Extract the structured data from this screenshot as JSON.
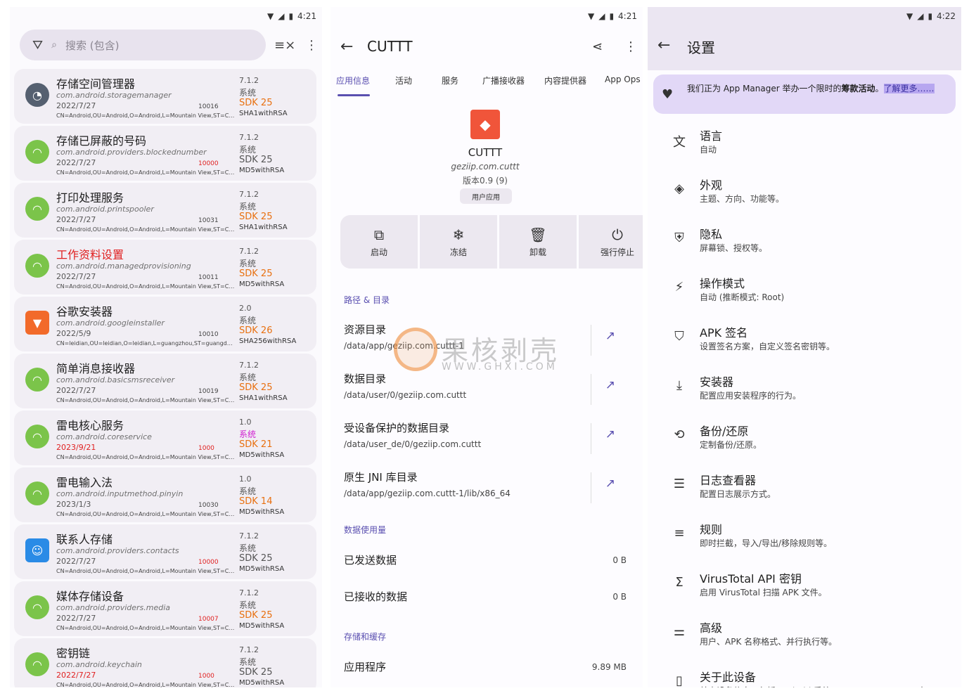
{
  "panel1": {
    "status": {
      "time": "4:21"
    },
    "search": {
      "placeholder": "搜索 (包含)"
    },
    "apps": [
      {
        "name": "存储空间管理器",
        "pkg": "com.android.storagemanager",
        "date": "2022/7/27",
        "uid": "10016",
        "cert": "CN=Android,OU=Android,O=Android,L=Mountain View,ST=Cali...",
        "version": "7.1.2",
        "type": "系统",
        "sdk": "SDK 25",
        "sig": "SHA1withRSA",
        "icon": "storage-icon"
      },
      {
        "name": "存储已屏蔽的号码",
        "pkg": "com.android.providers.blockednumber",
        "date": "2022/7/27",
        "uid": "10000",
        "cert": "CN=Android,OU=Android,O=Android,L=Mountain View,ST=Cali...",
        "version": "7.1.2",
        "type": "系统",
        "sdk": "SDK 25",
        "sig": "MD5withRSA",
        "icon": "android-icon"
      },
      {
        "name": "打印处理服务",
        "pkg": "com.android.printspooler",
        "date": "2022/7/27",
        "uid": "10031",
        "cert": "CN=Android,OU=Android,O=Android,L=Mountain View,ST=Cali...",
        "version": "7.1.2",
        "type": "系统",
        "sdk": "SDK 25",
        "sig": "SHA1withRSA",
        "icon": "android-icon"
      },
      {
        "name": "工作资料设置",
        "pkg": "com.android.managedprovisioning",
        "date": "2022/7/27",
        "uid": "10011",
        "cert": "CN=Android,OU=Android,O=Android,L=Mountain View,ST=Cali...",
        "version": "7.1.2",
        "type": "系统",
        "sdk": "SDK 25",
        "sig": "MD5withRSA",
        "icon": "android-icon"
      },
      {
        "name": "谷歌安装器",
        "pkg": "com.android.googleinstaller",
        "date": "2022/5/9",
        "uid": "10010",
        "cert": "CN=leidian,OU=leidian,O=leidian,L=guangzhou,ST=guangdon...",
        "version": "2.0",
        "type": "系统",
        "sdk": "SDK 26",
        "sig": "SHA256withRSA",
        "icon": "installer-icon"
      },
      {
        "name": "简单消息接收器",
        "pkg": "com.android.basicsmsreceiver",
        "date": "2022/7/27",
        "uid": "10019",
        "cert": "CN=Android,OU=Android,O=Android,L=Mountain View,ST=Cali...",
        "version": "7.1.2",
        "type": "系统",
        "sdk": "SDK 25",
        "sig": "SHA1withRSA",
        "icon": "android-icon"
      },
      {
        "name": "雷电核心服务",
        "pkg": "com.android.coreservice",
        "date": "2023/9/21",
        "uid": "1000",
        "cert": "CN=Android,OU=Android,O=Android,L=Mountain View,ST=Cali...",
        "version": "1.0",
        "type": "系统",
        "sdk": "SDK 21",
        "sig": "MD5withRSA",
        "icon": "android-icon"
      },
      {
        "name": "雷电输入法",
        "pkg": "com.android.inputmethod.pinyin",
        "date": "2023/1/3",
        "uid": "10030",
        "cert": "CN=Android,OU=Android,O=Android,L=Mountain View,ST=Cali...",
        "version": "1.0",
        "type": "系统",
        "sdk": "SDK 14",
        "sig": "MD5withRSA",
        "icon": "android-icon"
      },
      {
        "name": "联系人存储",
        "pkg": "com.android.providers.contacts",
        "date": "2022/7/27",
        "uid": "10000",
        "cert": "CN=Android,OU=Android,O=Android,L=Mountain View,ST=Cali...",
        "version": "7.1.2",
        "type": "系统",
        "sdk": "SDK 25",
        "sig": "MD5withRSA",
        "icon": "contacts-icon"
      },
      {
        "name": "媒体存储设备",
        "pkg": "com.android.providers.media",
        "date": "2022/7/27",
        "uid": "10007",
        "cert": "CN=Android,OU=Android,O=Android,L=Mountain View,ST=Cali...",
        "version": "7.1.2",
        "type": "系统",
        "sdk": "SDK 25",
        "sig": "MD5withRSA",
        "icon": "android-icon"
      },
      {
        "name": "密钥链",
        "pkg": "com.android.keychain",
        "date": "2022/7/27",
        "uid": "1000",
        "cert": "CN=Android,OU=Android,O=Android,L=Mountain View,ST=Cali...",
        "version": "7.1.2",
        "type": "系统",
        "sdk": "SDK 25",
        "sig": "MD5withRSA",
        "icon": "android-icon"
      }
    ]
  },
  "panel2": {
    "status": {
      "time": "4:21"
    },
    "title": "CUTTT",
    "tabs": [
      "应用信息",
      "活动",
      "服务",
      "广播接收器",
      "内容提供器",
      "App Ops"
    ],
    "app": {
      "name": "CUTTT",
      "pkg": "geziip.com.cuttt",
      "version": "版本0.9 (9)",
      "chip": "用户应用"
    },
    "actions": [
      {
        "label": "启动",
        "icon": "launch-icon"
      },
      {
        "label": "冻结",
        "icon": "freeze-icon"
      },
      {
        "label": "卸载",
        "icon": "trash-icon"
      },
      {
        "label": "强行停止",
        "icon": "power-icon"
      }
    ],
    "paths_header": "路径 & 目录",
    "paths": [
      {
        "title": "资源目录",
        "sub": "/data/app/geziip.com.cuttt-1"
      },
      {
        "title": "数据目录",
        "sub": "/data/user/0/geziip.com.cuttt"
      },
      {
        "title": "受设备保护的数据目录",
        "sub": "/data/user_de/0/geziip.com.cuttt"
      },
      {
        "title": "原生 JNI 库目录",
        "sub": "/data/app/geziip.com.cuttt-1/lib/x86_64"
      }
    ],
    "usage_header": "数据使用量",
    "usage": [
      {
        "label": "已发送数据",
        "value": "0 B"
      },
      {
        "label": "已接收的数据",
        "value": "0 B"
      }
    ],
    "storage_header": "存储和缓存",
    "storage": [
      {
        "label": "应用程序",
        "value": "9.89 MB"
      }
    ],
    "watermark": {
      "text": "果核剥壳",
      "sub": "WWW.GHXI.COM"
    }
  },
  "panel3": {
    "status": {
      "time": "4:22"
    },
    "title": "设置",
    "banner": {
      "text": "我们正为 App Manager 举办一个限时的",
      "bold": "筹款活动",
      "end": "。",
      "link": "了解更多……"
    },
    "settings": [
      {
        "title": "语言",
        "sub": "自动",
        "icon": "translate-icon"
      },
      {
        "title": "外观",
        "sub": "主题、方向、功能等。",
        "icon": "appearance-icon"
      },
      {
        "title": "隐私",
        "sub": "屏幕锁、授权等。",
        "icon": "privacy-shield-icon"
      },
      {
        "title": "操作模式",
        "sub": "自动 (推断模式: Root)",
        "icon": "run-mode-icon"
      },
      {
        "title": "APK 签名",
        "sub": "设置签名方案，自定义签名密钥等。",
        "icon": "signature-icon"
      },
      {
        "title": "安装器",
        "sub": "配置应用安装程序的行为。",
        "icon": "download-icon"
      },
      {
        "title": "备份/还原",
        "sub": "定制备份/还原。",
        "icon": "backup-icon"
      },
      {
        "title": "日志查看器",
        "sub": "配置日志展示方式。",
        "icon": "list-icon"
      },
      {
        "title": "规则",
        "sub": "即时拦截，导入/导出/移除规则等。",
        "icon": "rules-icon"
      },
      {
        "title": "VirusTotal API 密钥",
        "sub": "启用 VirusTotal 扫描 APK 文件。",
        "icon": "sigma-icon"
      },
      {
        "title": "高级",
        "sub": "用户、APK 名称格式、并行执行等。",
        "icon": "tune-icon"
      },
      {
        "title": "关于此设备",
        "sub": "基本设备信息，包括 Android 系统、CPU、GPU、RAM、电",
        "icon": "phone-icon"
      }
    ]
  }
}
